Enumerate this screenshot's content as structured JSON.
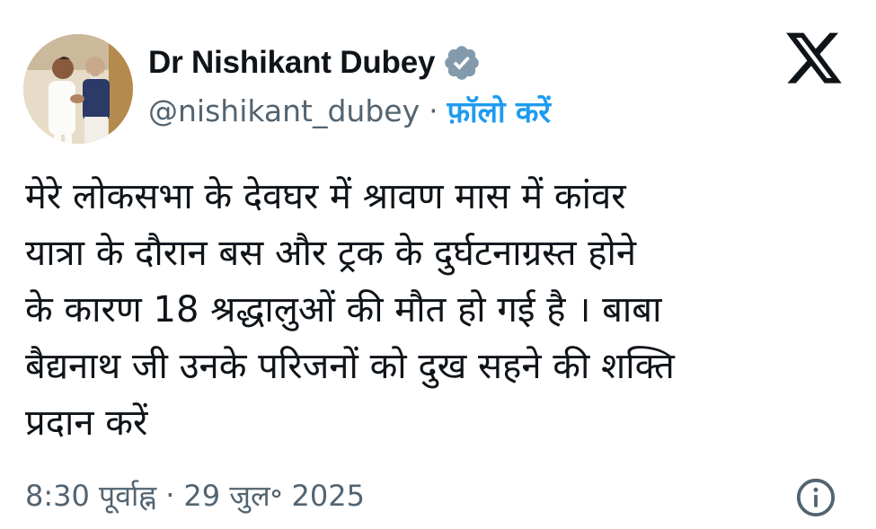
{
  "author": {
    "display_name": "Dr Nishikant Dubey",
    "handle": "@nishikant_dubey",
    "separator": "·",
    "follow_label": "फ़ॉलो करें",
    "verified_badge_color": "#829aab"
  },
  "icons": {
    "avatar": "profile-photo",
    "verified": "verified-badge-icon",
    "brand": "x-logo-icon",
    "info": "info-icon"
  },
  "tweet": {
    "text": "मेरे लोकसभा के देवघर में श्रावण मास में कांवर\nयात्रा के दौरान बस और ट्रक के दुर्घटनाग्रस्त होने\nके कारण 18 श्रद्धालुओं की मौत हो गई है । बाबा\nबैद्यनाथ जी उनके परिजनों को दुख सहने की शक्ति\nप्रदान करें"
  },
  "meta": {
    "time": "8:30 पूर्वाह्न",
    "separator": "·",
    "date": "29 जुल॰ 2025"
  },
  "colors": {
    "text_primary": "#0f1419",
    "text_secondary": "#536471",
    "link": "#1d9bf0",
    "background": "#ffffff"
  }
}
